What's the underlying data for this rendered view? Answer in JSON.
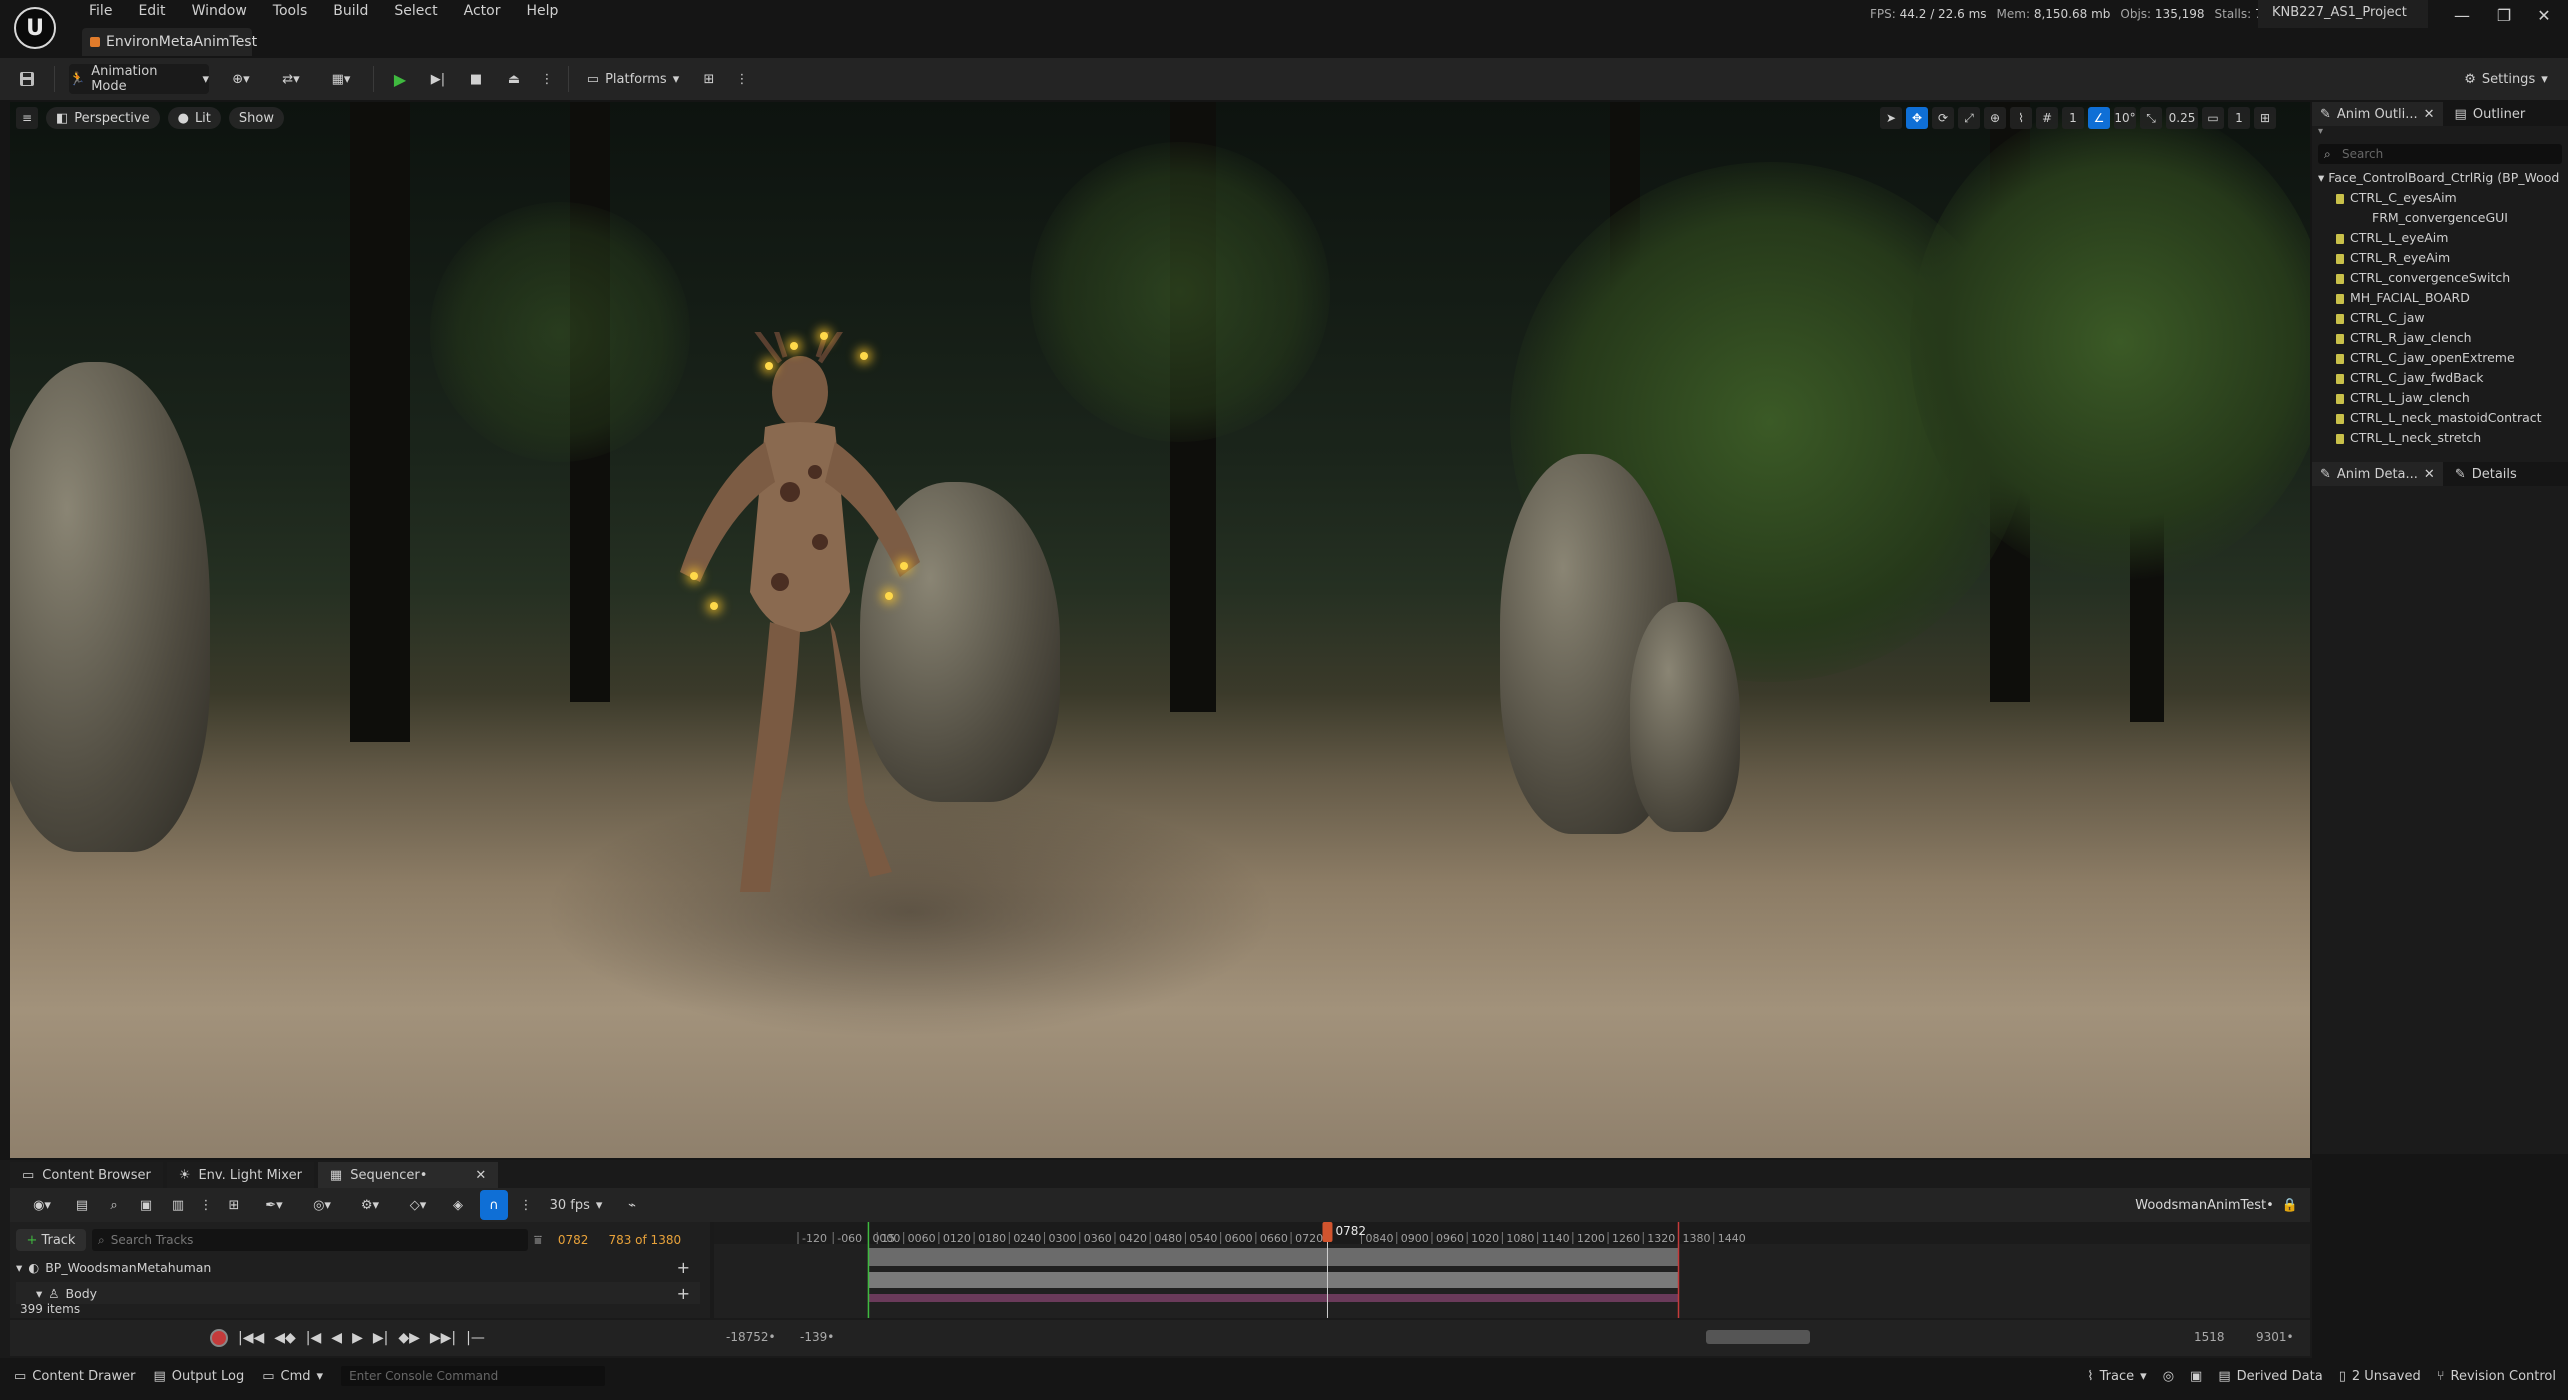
{
  "app": {
    "logo_letter": "U",
    "menu": [
      "File",
      "Edit",
      "Window",
      "Tools",
      "Build",
      "Select",
      "Actor",
      "Help"
    ],
    "document_tab": "EnvironMetaAnimTest",
    "stats": {
      "fps_label": "FPS:",
      "fps": "44.2",
      "ms": "/ 22.6 ms",
      "mem_label": "Mem:",
      "mem": "8,150.68 mb",
      "objs_label": "Objs:",
      "objs": "135,198",
      "stalls_label": "Stalls:",
      "stalls": "7"
    },
    "project": "KNB227_AS1_Project",
    "window_buttons": {
      "minimize": "—",
      "maximize": "❐",
      "close": "✕"
    }
  },
  "toolbar": {
    "mode_label": "Animation Mode",
    "platforms_label": "Platforms",
    "settings_label": "Settings"
  },
  "viewport": {
    "perspective_label": "Perspective",
    "lit_label": "Lit",
    "show_label": "Show",
    "grid_value": "1",
    "angle_value": "10°",
    "scale_value": "0.25",
    "camera_value": "1"
  },
  "outliner": {
    "tabs": [
      "Anim Outli...",
      "Outliner"
    ],
    "search_placeholder": "Search",
    "root": "Face_ControlBoard_CtrlRig (BP_Wood",
    "items": [
      {
        "label": "CTRL_C_eyesAim",
        "indent": 1
      },
      {
        "label": "FRM_convergenceGUI",
        "indent": 2
      },
      {
        "label": "CTRL_L_eyeAim",
        "indent": 1
      },
      {
        "label": "CTRL_R_eyeAim",
        "indent": 1
      },
      {
        "label": "CTRL_convergenceSwitch",
        "indent": 1
      },
      {
        "label": "MH_FACIAL_BOARD",
        "indent": 1
      },
      {
        "label": "CTRL_C_jaw",
        "indent": 1
      },
      {
        "label": "CTRL_R_jaw_clench",
        "indent": 1
      },
      {
        "label": "CTRL_C_jaw_openExtreme",
        "indent": 1
      },
      {
        "label": "CTRL_C_jaw_fwdBack",
        "indent": 1
      },
      {
        "label": "CTRL_L_jaw_clench",
        "indent": 1
      },
      {
        "label": "CTRL_L_neck_mastoidContract",
        "indent": 1
      },
      {
        "label": "CTRL_L_neck_stretch",
        "indent": 1
      }
    ]
  },
  "details": {
    "tabs": [
      "Anim Deta...",
      "Details"
    ]
  },
  "bottom_tabs": [
    "Content Browser",
    "Env. Light Mixer",
    "Sequencer•"
  ],
  "sequencer": {
    "fps_label": "30 fps",
    "sequence_name": "WoodsmanAnimTest•",
    "track_button": "Track",
    "search_placeholder": "Search Tracks",
    "current_frame": "0782",
    "frame_count": "783 of 1380",
    "playhead_label": "0782",
    "ruler_labels": [
      "-120",
      "-060",
      "0000",
      "0060",
      "0120",
      "0180",
      "0240",
      "0300",
      "0360",
      "0420",
      "0480",
      "0540",
      "0600",
      "0660",
      "0720",
      "0840",
      "0900",
      "0960",
      "1020",
      "1080",
      "1140",
      "1200",
      "1260",
      "1320",
      "1380",
      "1440",
      "15"
    ],
    "tracks": [
      "BP_WoodsmanMetahuman",
      "Body"
    ],
    "items_count": "399 items",
    "view_start": "-18752•",
    "view_in": "-139•",
    "view_out": "1518",
    "view_end": "9301•"
  },
  "statusbar": {
    "content_drawer": "Content Drawer",
    "output_log": "Output Log",
    "cmd": "Cmd",
    "console_placeholder": "Enter Console Command",
    "trace": "Trace",
    "derived_data": "Derived Data",
    "unsaved": "2 Unsaved",
    "revision_control": "Revision Control"
  },
  "colors": {
    "accent": "#0f6fd6",
    "play_green": "#3fb93f",
    "record_red": "#c43b3b",
    "playhead": "#d1542e"
  }
}
